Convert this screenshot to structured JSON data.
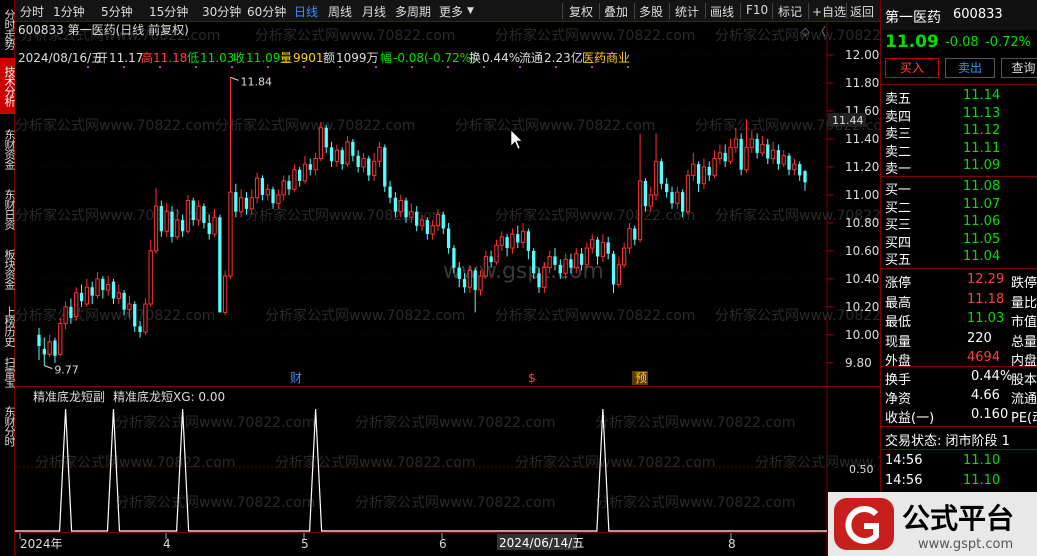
{
  "left_tabs": [
    "分时走势",
    "技术分析",
    "东财资金",
    "东财日资",
    "板块资金",
    "上榜历史",
    "扫雷宝",
    "东财分时"
  ],
  "toolbar": {
    "left_items": [
      "分时",
      "1分钟",
      "5分钟",
      "15分钟",
      "30分钟",
      "60分钟",
      "日线",
      "周线",
      "月线",
      "多周期",
      "更多"
    ],
    "active": "日线",
    "right_items": [
      "复权",
      "叠加",
      "多股",
      "统计",
      "画线",
      "F10",
      "标记",
      "+自选",
      "返回"
    ]
  },
  "chart_header": {
    "code_title": "600833 第一医药(日线 前复权)",
    "date": "2024/08/16/五",
    "open_label": "开",
    "open": "11.17",
    "high_label": "高",
    "high": "11.18",
    "low_label": "低",
    "low": "11.03",
    "close_label": "收",
    "close": "11.09",
    "vol_label": "量",
    "vol": "9901",
    "amount_label": "额",
    "amount": "1099万",
    "change_label": "幅",
    "change": "-0.08(-0.72%)",
    "turnover_label": "换",
    "turnover": "0.44%",
    "float_label": "流通",
    "float": "2.23亿",
    "industry": "医药商业"
  },
  "price_markers": {
    "max": "11.84",
    "min": "9.77",
    "last": "11.44"
  },
  "event_markers": [
    "财",
    "$",
    "预"
  ],
  "indicator": {
    "name": "精准底龙短副",
    "line_label": "精准底龙短XG: 0.00",
    "level": "0.50"
  },
  "watermark": "分析家公式网www.70822.com",
  "center_watermark": "www.gspt.com",
  "chart_data": {
    "type": "candlestick",
    "y_ticks": [
      "12.00",
      "11.80",
      "11.60",
      "11.40",
      "11.20",
      "11.00",
      "10.80",
      "10.60",
      "10.40",
      "10.20",
      "10.00",
      "9.80"
    ],
    "ylim": [
      9.72,
      12.05
    ],
    "x_tick_labels": [
      "2024年",
      "4",
      "5",
      "6",
      "2024/06/14/五",
      "8"
    ],
    "candles": [
      [
        10.0,
        9.92,
        10.05,
        9.82
      ],
      [
        9.9,
        9.86,
        9.98,
        9.78
      ],
      [
        9.86,
        9.95,
        10.0,
        9.84
      ],
      [
        9.96,
        9.85,
        9.98,
        9.8
      ],
      [
        9.86,
        10.08,
        10.12,
        9.85
      ],
      [
        10.08,
        10.2,
        10.24,
        10.04
      ],
      [
        10.2,
        10.12,
        10.26,
        10.08
      ],
      [
        10.13,
        10.3,
        10.34,
        10.1
      ],
      [
        10.3,
        10.24,
        10.36,
        10.2
      ],
      [
        10.22,
        10.34,
        10.4,
        10.2
      ],
      [
        10.34,
        10.28,
        10.38,
        10.22
      ],
      [
        10.28,
        10.4,
        10.45,
        10.26
      ],
      [
        10.4,
        10.32,
        10.42,
        10.26
      ],
      [
        10.32,
        10.36,
        10.42,
        10.28
      ],
      [
        10.38,
        10.26,
        10.4,
        10.22
      ],
      [
        10.26,
        10.3,
        10.36,
        10.22
      ],
      [
        10.3,
        10.18,
        10.32,
        10.14
      ],
      [
        10.18,
        10.22,
        10.28,
        10.12
      ],
      [
        10.22,
        10.06,
        10.24,
        10.02
      ],
      [
        10.06,
        10.02,
        10.1,
        9.98
      ],
      [
        10.02,
        10.22,
        10.26,
        10.0
      ],
      [
        10.22,
        10.6,
        10.68,
        10.2
      ],
      [
        10.6,
        10.92,
        11.05,
        10.58
      ],
      [
        10.92,
        10.74,
        10.96,
        10.7
      ],
      [
        10.74,
        10.88,
        10.94,
        10.7
      ],
      [
        10.88,
        10.7,
        10.92,
        10.66
      ],
      [
        10.7,
        10.82,
        10.9,
        10.68
      ],
      [
        10.82,
        10.74,
        10.86,
        10.7
      ],
      [
        10.74,
        10.96,
        11.0,
        10.72
      ],
      [
        10.96,
        10.82,
        10.98,
        10.78
      ],
      [
        10.82,
        10.92,
        10.96,
        10.78
      ],
      [
        10.92,
        10.8,
        10.94,
        10.76
      ],
      [
        10.8,
        10.72,
        10.86,
        10.68
      ],
      [
        10.72,
        10.84,
        10.9,
        10.7
      ],
      [
        10.84,
        10.16,
        10.86,
        10.16
      ],
      [
        10.16,
        10.42,
        10.46,
        10.14
      ],
      [
        10.42,
        11.02,
        11.84,
        10.4
      ],
      [
        11.02,
        10.88,
        11.08,
        10.84
      ],
      [
        10.88,
        10.98,
        11.04,
        10.84
      ],
      [
        10.98,
        10.9,
        11.02,
        10.86
      ],
      [
        10.9,
        10.98,
        11.04,
        10.86
      ],
      [
        10.98,
        11.12,
        11.16,
        10.94
      ],
      [
        11.12,
        11.0,
        11.14,
        10.96
      ],
      [
        11.0,
        11.04,
        11.08,
        10.96
      ],
      [
        11.04,
        10.94,
        11.06,
        10.9
      ],
      [
        10.94,
        11.0,
        11.04,
        10.9
      ],
      [
        11.0,
        11.1,
        11.14,
        10.96
      ],
      [
        11.1,
        11.04,
        11.14,
        11.0
      ],
      [
        11.04,
        11.18,
        11.22,
        11.02
      ],
      [
        11.18,
        11.1,
        11.2,
        11.06
      ],
      [
        11.1,
        11.22,
        11.28,
        11.08
      ],
      [
        11.22,
        11.18,
        11.26,
        11.14
      ],
      [
        11.18,
        11.26,
        11.3,
        11.14
      ],
      [
        11.26,
        11.48,
        11.52,
        11.24
      ],
      [
        11.48,
        11.34,
        11.5,
        11.3
      ],
      [
        11.34,
        11.24,
        11.38,
        11.2
      ],
      [
        11.24,
        11.32,
        11.36,
        11.2
      ],
      [
        11.32,
        11.22,
        11.34,
        11.18
      ],
      [
        11.22,
        11.38,
        11.42,
        11.2
      ],
      [
        11.38,
        11.28,
        11.4,
        11.24
      ],
      [
        11.28,
        11.2,
        11.32,
        11.16
      ],
      [
        11.2,
        11.26,
        11.3,
        11.16
      ],
      [
        11.26,
        11.14,
        11.28,
        11.1
      ],
      [
        11.14,
        11.24,
        11.3,
        11.1
      ],
      [
        11.24,
        11.34,
        11.38,
        11.2
      ],
      [
        11.34,
        11.06,
        11.36,
        11.02
      ],
      [
        11.06,
        10.98,
        11.1,
        10.94
      ],
      [
        10.98,
        10.88,
        11.02,
        10.84
      ],
      [
        10.88,
        10.96,
        11.0,
        10.84
      ],
      [
        10.96,
        10.84,
        10.98,
        10.8
      ],
      [
        10.84,
        10.88,
        10.94,
        10.8
      ],
      [
        10.88,
        10.78,
        10.92,
        10.74
      ],
      [
        10.78,
        10.82,
        10.86,
        10.74
      ],
      [
        10.82,
        10.72,
        10.84,
        10.68
      ],
      [
        10.72,
        10.78,
        10.82,
        10.68
      ],
      [
        10.78,
        10.86,
        10.9,
        10.74
      ],
      [
        10.86,
        10.76,
        10.88,
        10.72
      ],
      [
        10.76,
        10.62,
        10.8,
        10.58
      ],
      [
        10.62,
        10.48,
        10.64,
        10.44
      ],
      [
        10.48,
        10.4,
        10.52,
        10.34
      ],
      [
        10.4,
        10.34,
        10.44,
        10.3
      ],
      [
        10.34,
        10.46,
        10.5,
        10.3
      ],
      [
        10.46,
        10.32,
        10.48,
        10.16
      ],
      [
        10.32,
        10.42,
        10.46,
        10.28
      ],
      [
        10.42,
        10.56,
        10.6,
        10.4
      ],
      [
        10.56,
        10.52,
        10.6,
        10.48
      ],
      [
        10.52,
        10.64,
        10.68,
        10.5
      ],
      [
        10.64,
        10.7,
        10.74,
        10.6
      ],
      [
        10.7,
        10.62,
        10.72,
        10.56
      ],
      [
        10.62,
        10.72,
        10.76,
        10.58
      ],
      [
        10.72,
        10.66,
        10.78,
        10.62
      ],
      [
        10.66,
        10.74,
        10.8,
        10.62
      ],
      [
        10.74,
        10.6,
        10.76,
        10.54
      ],
      [
        10.6,
        10.44,
        10.62,
        10.4
      ],
      [
        10.44,
        10.34,
        10.48,
        10.3
      ],
      [
        10.34,
        10.48,
        10.52,
        10.3
      ],
      [
        10.48,
        10.56,
        10.6,
        10.44
      ],
      [
        10.56,
        10.5,
        10.62,
        10.46
      ],
      [
        10.5,
        10.44,
        10.54,
        10.4
      ],
      [
        10.44,
        10.54,
        10.58,
        10.4
      ],
      [
        10.54,
        10.48,
        10.58,
        10.44
      ],
      [
        10.48,
        10.58,
        10.62,
        10.44
      ],
      [
        10.58,
        10.5,
        10.62,
        10.46
      ],
      [
        10.5,
        10.62,
        10.66,
        10.48
      ],
      [
        10.62,
        10.68,
        10.72,
        10.58
      ],
      [
        10.68,
        10.56,
        10.7,
        10.5
      ],
      [
        10.56,
        10.66,
        10.72,
        10.52
      ],
      [
        10.66,
        10.58,
        10.7,
        10.54
      ],
      [
        10.58,
        10.36,
        10.6,
        10.3
      ],
      [
        10.36,
        10.5,
        10.56,
        10.34
      ],
      [
        10.5,
        10.62,
        10.66,
        10.48
      ],
      [
        10.62,
        10.76,
        10.8,
        10.58
      ],
      [
        10.76,
        10.68,
        10.78,
        10.64
      ],
      [
        10.68,
        11.1,
        11.44,
        10.66
      ],
      [
        11.1,
        10.92,
        11.12,
        10.88
      ],
      [
        10.92,
        11.0,
        11.06,
        10.88
      ],
      [
        11.0,
        11.24,
        11.44,
        10.96
      ],
      [
        11.24,
        11.08,
        11.26,
        11.04
      ],
      [
        11.08,
        11.02,
        11.12,
        10.98
      ],
      [
        11.02,
        10.94,
        11.06,
        10.9
      ],
      [
        10.94,
        11.02,
        11.06,
        10.9
      ],
      [
        11.02,
        10.88,
        11.04,
        10.84
      ],
      [
        10.88,
        11.14,
        11.18,
        10.86
      ],
      [
        11.14,
        11.22,
        11.3,
        11.1
      ],
      [
        11.22,
        11.08,
        11.24,
        11.02
      ],
      [
        11.08,
        11.2,
        11.26,
        11.04
      ],
      [
        11.2,
        11.14,
        11.24,
        11.1
      ],
      [
        11.14,
        11.26,
        11.32,
        11.12
      ],
      [
        11.26,
        11.3,
        11.36,
        11.22
      ],
      [
        11.3,
        11.24,
        11.36,
        11.2
      ],
      [
        11.24,
        11.34,
        11.4,
        11.22
      ],
      [
        11.34,
        11.4,
        11.48,
        11.3
      ],
      [
        11.4,
        11.18,
        11.44,
        11.14
      ],
      [
        11.18,
        11.34,
        11.54,
        11.16
      ],
      [
        11.34,
        11.4,
        11.46,
        11.3
      ],
      [
        11.4,
        11.3,
        11.44,
        11.26
      ],
      [
        11.3,
        11.36,
        11.42,
        11.28
      ],
      [
        11.36,
        11.26,
        11.4,
        11.22
      ],
      [
        11.26,
        11.32,
        11.38,
        11.22
      ],
      [
        11.32,
        11.22,
        11.36,
        11.18
      ],
      [
        11.22,
        11.28,
        11.32,
        11.2
      ],
      [
        11.28,
        11.18,
        11.3,
        11.14
      ],
      [
        11.18,
        11.22,
        11.26,
        11.14
      ],
      [
        11.22,
        11.14,
        11.24,
        11.1
      ],
      [
        11.17,
        11.09,
        11.18,
        11.03
      ]
    ],
    "signals": [
      5,
      14,
      27,
      52,
      106
    ]
  },
  "quote_panel": {
    "name": "第一医药",
    "code": "600833",
    "price": "11.09",
    "change": "-0.08",
    "pct": "-0.72%",
    "buy_btn": "买入",
    "sell_btn": "卖出",
    "query_btn": "查询",
    "asks": [
      [
        "卖五",
        "11.14"
      ],
      [
        "卖四",
        "11.13"
      ],
      [
        "卖三",
        "11.12"
      ],
      [
        "卖二",
        "11.11"
      ],
      [
        "卖一",
        "11.09"
      ]
    ],
    "bids": [
      [
        "买一",
        "11.08"
      ],
      [
        "买二",
        "11.07"
      ],
      [
        "买三",
        "11.06"
      ],
      [
        "买四",
        "11.05"
      ],
      [
        "买五",
        "11.04"
      ]
    ],
    "stats": [
      [
        "涨停",
        "12.29",
        "跌停"
      ],
      [
        "最高",
        "11.18",
        "量比"
      ],
      [
        "最低",
        "11.03",
        "市值"
      ],
      [
        "现量",
        "220",
        "总量"
      ],
      [
        "外盘",
        "4694",
        "内盘"
      ]
    ],
    "fund": [
      [
        "换手",
        "0.44%",
        "股本"
      ],
      [
        "净资",
        "4.66",
        "流通"
      ],
      [
        "收益(一)",
        "0.160",
        "PE(动"
      ]
    ],
    "status_label": "交易状态: 闭市阶段 1",
    "ticks": [
      [
        "14:56",
        "11.10"
      ],
      [
        "14:56",
        "11.10"
      ],
      [
        "14:56",
        "11.10"
      ]
    ]
  },
  "logo": {
    "text": "公式平台",
    "url": "www.gspt.com"
  }
}
